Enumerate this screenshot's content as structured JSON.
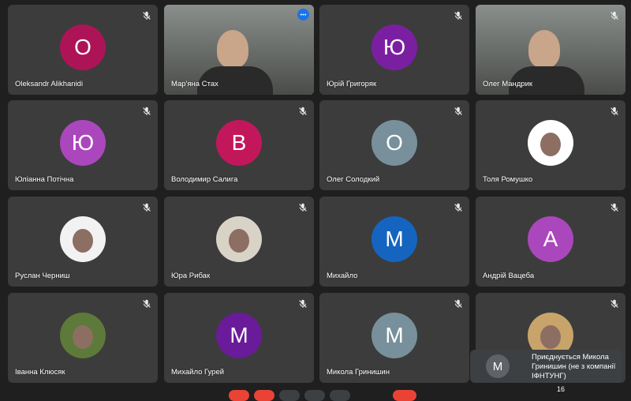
{
  "participants": [
    {
      "name": "Oleksandr Alikhanidi",
      "initial": "O",
      "color": "#ad1457",
      "kind": "letter",
      "muted": true
    },
    {
      "name": "Мар'яна Стах",
      "initial": "",
      "color": "#5a5a55",
      "kind": "video",
      "muted": false,
      "active": true
    },
    {
      "name": "Юрій Григоряк",
      "initial": "Ю",
      "color": "#7b1fa2",
      "kind": "letter",
      "muted": true
    },
    {
      "name": "Олег Мандрик",
      "initial": "",
      "color": "#6b6b66",
      "kind": "video",
      "muted": true
    },
    {
      "name": "Юліанна Потічна",
      "initial": "Ю",
      "color": "#ab47bc",
      "kind": "letter",
      "muted": true
    },
    {
      "name": "Володимир Салига",
      "initial": "В",
      "color": "#c2185b",
      "kind": "letter",
      "muted": true
    },
    {
      "name": "Олег Солодкий",
      "initial": "О",
      "color": "#78909c",
      "kind": "letter",
      "muted": true
    },
    {
      "name": "Толя Ромушко",
      "initial": "",
      "color": "#ffffff",
      "kind": "photo",
      "muted": true
    },
    {
      "name": "Руслан Черниш",
      "initial": "",
      "color": "#f2f2f2",
      "kind": "photo",
      "muted": true
    },
    {
      "name": "Юра Рибак",
      "initial": "",
      "color": "#d9d3c7",
      "kind": "photo",
      "muted": true
    },
    {
      "name": "Михайло",
      "initial": "М",
      "color": "#1565c0",
      "kind": "letter",
      "muted": true
    },
    {
      "name": "Андрій Вацеба",
      "initial": "А",
      "color": "#ab47bc",
      "kind": "letter",
      "muted": true
    },
    {
      "name": "Іванна Клюсяк",
      "initial": "",
      "color": "#5d7a3a",
      "kind": "photo",
      "muted": true
    },
    {
      "name": "Михайло Гурей",
      "initial": "М",
      "color": "#6a1b9a",
      "kind": "letter",
      "muted": true
    },
    {
      "name": "Микола Гринишин",
      "initial": "М",
      "color": "#78909c",
      "kind": "letter",
      "muted": true
    },
    {
      "name": "",
      "initial": "",
      "color": "#c8a46a",
      "kind": "photo",
      "muted": true
    }
  ],
  "toast": {
    "initial": "М",
    "text": "Приєднується Микола Гринишин (не з компанії ІФНТУНГ)"
  },
  "participant_count": "16",
  "accent_color": "#1a73e8",
  "icons": [
    "mic-off-icon",
    "more-options-icon"
  ]
}
